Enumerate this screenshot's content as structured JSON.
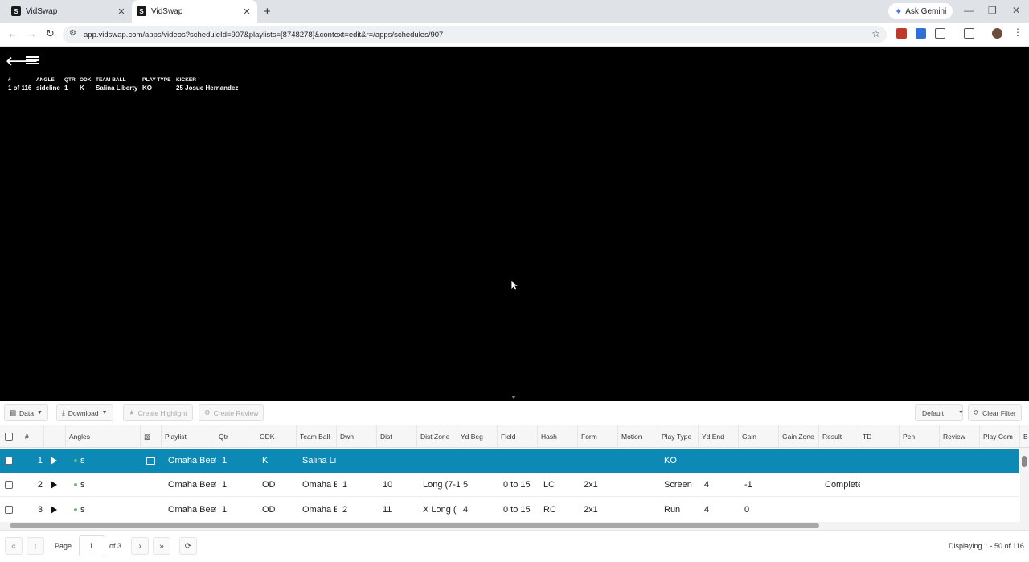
{
  "browser": {
    "tabs": [
      {
        "title": "VidSwap",
        "favicon": "S"
      },
      {
        "title": "VidSwap",
        "favicon": "S"
      }
    ],
    "new_tab": "+",
    "gemini_label": "Ask Gemini",
    "url": "app.vidswap.com/apps/videos?scheduleId=907&playlists=[8748278]&context=edit&r=/apps/schedules/907",
    "window_controls": [
      "—",
      "❐",
      "✕"
    ]
  },
  "overlay": {
    "headers": [
      "#",
      "ANGLE",
      "QTR",
      "ODK",
      "TEAM BALL",
      "PLAY TYPE",
      "KICKER"
    ],
    "values": [
      "1 of 116",
      "sideline",
      "1",
      "K",
      "Salina Liberty",
      "KO",
      "25 Josue Hernandez"
    ]
  },
  "toolbar": {
    "data_label": "Data",
    "download_label": "Download",
    "create_highlight_label": "Create Highlight",
    "create_review_label": "Create Review",
    "default_label": "Default",
    "clear_filter_label": "Clear Filter"
  },
  "grid": {
    "columns": [
      "#",
      "Angles",
      "Playlist",
      "Qtr",
      "ODK",
      "Team Ball",
      "Dwn",
      "Dist",
      "Dist Zone",
      "Yd Beg",
      "Field",
      "Hash",
      "Form",
      "Motion",
      "Play Type",
      "Yd End",
      "Gain",
      "Gain Zone",
      "Result",
      "TD",
      "Pen",
      "Review",
      "Play Com",
      "B"
    ],
    "rows": [
      {
        "num": "1",
        "angle": "s",
        "playlist": "Omaha Beef",
        "qtr": "1",
        "odk": "K",
        "team": "Salina Lil",
        "dwn": "",
        "dist": "",
        "dist_zone": "",
        "yd_beg": "",
        "field": "",
        "hash": "",
        "form": "",
        "play_type": "KO",
        "yd_end": "",
        "gain": "",
        "result": ""
      },
      {
        "num": "2",
        "angle": "s",
        "playlist": "Omaha Beef",
        "qtr": "1",
        "odk": "OD",
        "team": "Omaha E",
        "dwn": "1",
        "dist": "10",
        "dist_zone": "Long (7-1",
        "yd_beg": "5",
        "field": "0 to 15",
        "hash": "LC",
        "form": "2x1",
        "play_type": "Screen",
        "yd_end": "4",
        "gain": "-1",
        "result": "Complete"
      },
      {
        "num": "3",
        "angle": "s",
        "playlist": "Omaha Beef",
        "qtr": "1",
        "odk": "OD",
        "team": "Omaha E",
        "dwn": "2",
        "dist": "11",
        "dist_zone": "X Long (",
        "yd_beg": "4",
        "field": "0 to 15",
        "hash": "RC",
        "form": "2x1",
        "play_type": "Run",
        "yd_end": "4",
        "gain": "0",
        "result": ""
      }
    ]
  },
  "pager": {
    "page_label": "Page",
    "page_value": "1",
    "of_label": "of 3",
    "display_text": "Displaying 1 - 50 of 116"
  }
}
